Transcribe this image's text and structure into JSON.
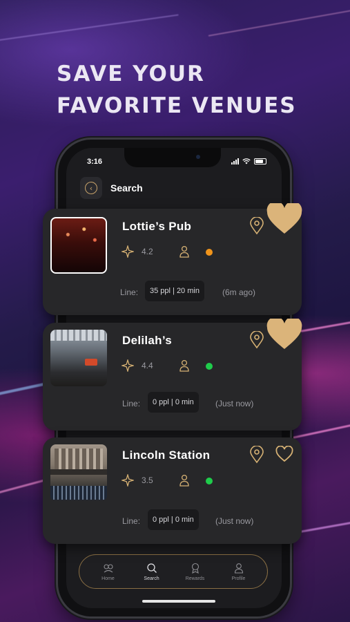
{
  "promo": {
    "line1": "SAVE YOUR",
    "line2": "FAVORITE VENUES"
  },
  "status_bar": {
    "time": "3:16"
  },
  "header": {
    "title": "Search",
    "back_icon": "chevron-left-circle-icon"
  },
  "venues": [
    {
      "name": "Lottie’s Pub",
      "rating": "4.2",
      "status_color": "#f0941b",
      "line_label": "Line:",
      "line_value": "35 ppl | 20 min",
      "updated": "(6m ago)",
      "favorited": true
    },
    {
      "name": "Delilah’s",
      "rating": "4.4",
      "status_color": "#1fcc4b",
      "line_label": "Line:",
      "line_value": "0 ppl | 0 min",
      "updated": "(Just now)",
      "favorited": true
    },
    {
      "name": "Lincoln Station",
      "rating": "3.5",
      "status_color": "#1fcc4b",
      "line_label": "Line:",
      "line_value": "0 ppl | 0 min",
      "updated": "(Just now)",
      "favorited": false
    }
  ],
  "tabs": [
    {
      "label": "Home",
      "icon": "home-icon",
      "active": false
    },
    {
      "label": "Search",
      "icon": "search-icon",
      "active": true
    },
    {
      "label": "Rewards",
      "icon": "rewards-icon",
      "active": false
    },
    {
      "label": "Profile",
      "icon": "profile-icon",
      "active": false
    }
  ],
  "colors": {
    "accent_gold": "#d7b274",
    "card_bg": "#272729",
    "screen_bg": "#1c1c1f"
  }
}
